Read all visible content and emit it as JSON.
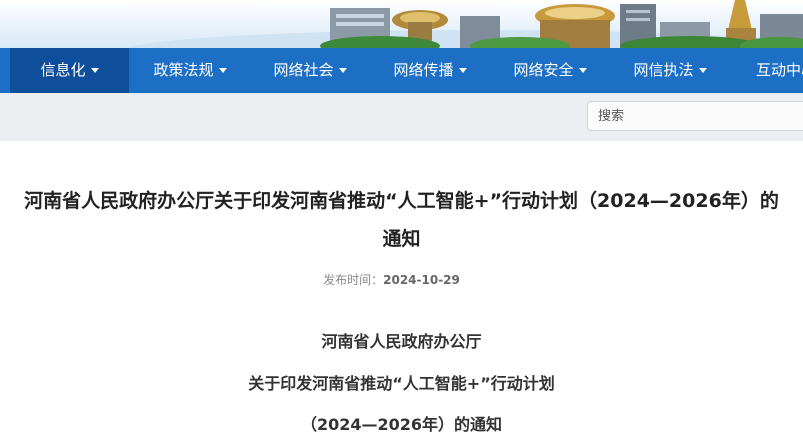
{
  "nav": {
    "items": [
      {
        "label": "信息化"
      },
      {
        "label": "政策法规"
      },
      {
        "label": "网络社会"
      },
      {
        "label": "网络传播"
      },
      {
        "label": "网络安全"
      },
      {
        "label": "网信执法"
      },
      {
        "label": "互动中心"
      }
    ],
    "active_color": "#0f4e9a",
    "bar_color": "#1d6fc6"
  },
  "search": {
    "placeholder": "搜索"
  },
  "article": {
    "title_line1": "河南省人民政府办公厅关于印发河南省推动“人工智能+”行动计划（2024—2026年）的",
    "title_line2": "通知",
    "date_label": "发布时间：",
    "date": "2024-10-29",
    "body_lines": [
      "河南省人民政府办公厅",
      "关于印发河南省推动“人工智能+”行动计划",
      "（2024—2026年）的通知"
    ]
  }
}
